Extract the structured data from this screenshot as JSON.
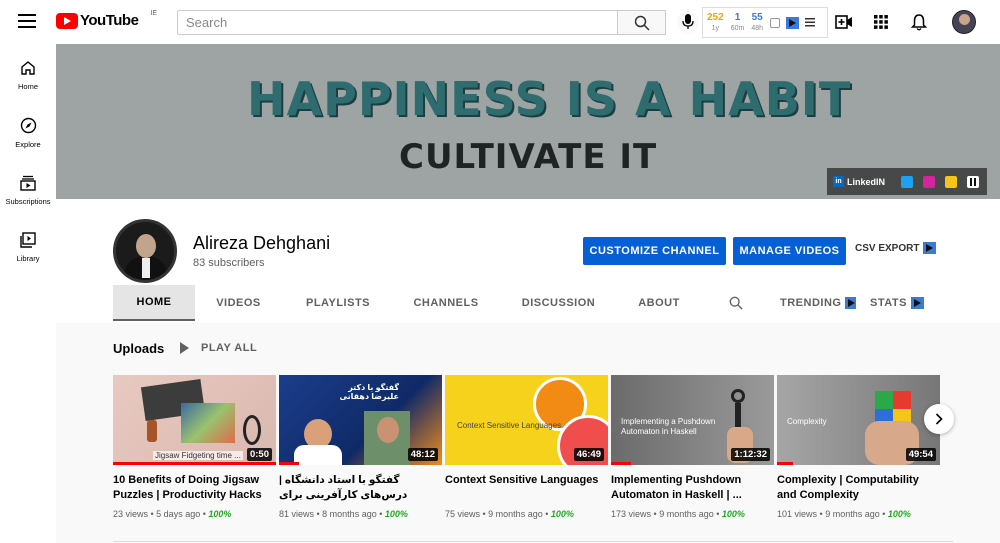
{
  "topbar": {
    "logo_text": "YouTube",
    "country_code": "IE",
    "search_placeholder": "Search",
    "stats": [
      {
        "value": "252",
        "sub": "1y",
        "color": "#f0a500"
      },
      {
        "value": "1",
        "sub": "60m",
        "color": "#3a7bd5"
      },
      {
        "value": "55",
        "sub": "48h",
        "color": "#3a7bd5"
      }
    ]
  },
  "sidebar": {
    "items": [
      {
        "label": "Home",
        "icon": "home-icon"
      },
      {
        "label": "Explore",
        "icon": "compass-icon"
      },
      {
        "label": "Subscriptions",
        "icon": "subscriptions-icon"
      },
      {
        "label": "Library",
        "icon": "library-icon"
      }
    ]
  },
  "banner": {
    "line1": "HAPPINESS IS A HABIT",
    "line2": "CULTIVATE IT",
    "linkedin_label": "LinkedIN"
  },
  "channel": {
    "name": "Alireza Dehghani",
    "subscribers": "83 subscribers",
    "customize_label": "CUSTOMIZE CHANNEL",
    "manage_label": "MANAGE VIDEOS",
    "csv_label": "CSV EXPORT"
  },
  "tabs": [
    "HOME",
    "VIDEOS",
    "PLAYLISTS",
    "CHANNELS",
    "DISCUSSION",
    "ABOUT",
    "TRENDING",
    "STATS"
  ],
  "uploads": {
    "title": "Uploads",
    "play_all": "PLAY ALL",
    "videos": [
      {
        "title": "10 Benefits of Doing Jigsaw Puzzles | Productivity Hacks",
        "views": "23 views",
        "age": "5 days ago",
        "score": "100%",
        "duration": "0:50",
        "thumb_caption": "Jigsaw Fidgeting time ...",
        "progress": 1.0
      },
      {
        "title": "گفتگو با استاد دانشگاه | درس‌های کارآفرینی برای دانشجویان مهندسی",
        "views": "81 views",
        "age": "8 months ago",
        "score": "100%",
        "duration": "48:12",
        "thumb_caption": "گفتگو با دکتر علیرضا دهقانی",
        "progress": 0.12
      },
      {
        "title": "Context Sensitive Languages",
        "views": "75 views",
        "age": "9 months ago",
        "score": "100%",
        "duration": "46:49",
        "thumb_caption": "Context Sensitive Languages",
        "progress": 0.0
      },
      {
        "title": "Implementing Pushdown Automaton in Haskell | ...",
        "views": "173 views",
        "age": "9 months ago",
        "score": "100%",
        "duration": "1:12:32",
        "thumb_caption": "Implementing a Pushdown Automaton in Haskell",
        "progress": 0.12
      },
      {
        "title": "Complexity | Computability and Complexity",
        "views": "101 views",
        "age": "9 months ago",
        "score": "100%",
        "duration": "49:54",
        "thumb_caption": "Complexity",
        "progress": 0.1
      }
    ]
  }
}
